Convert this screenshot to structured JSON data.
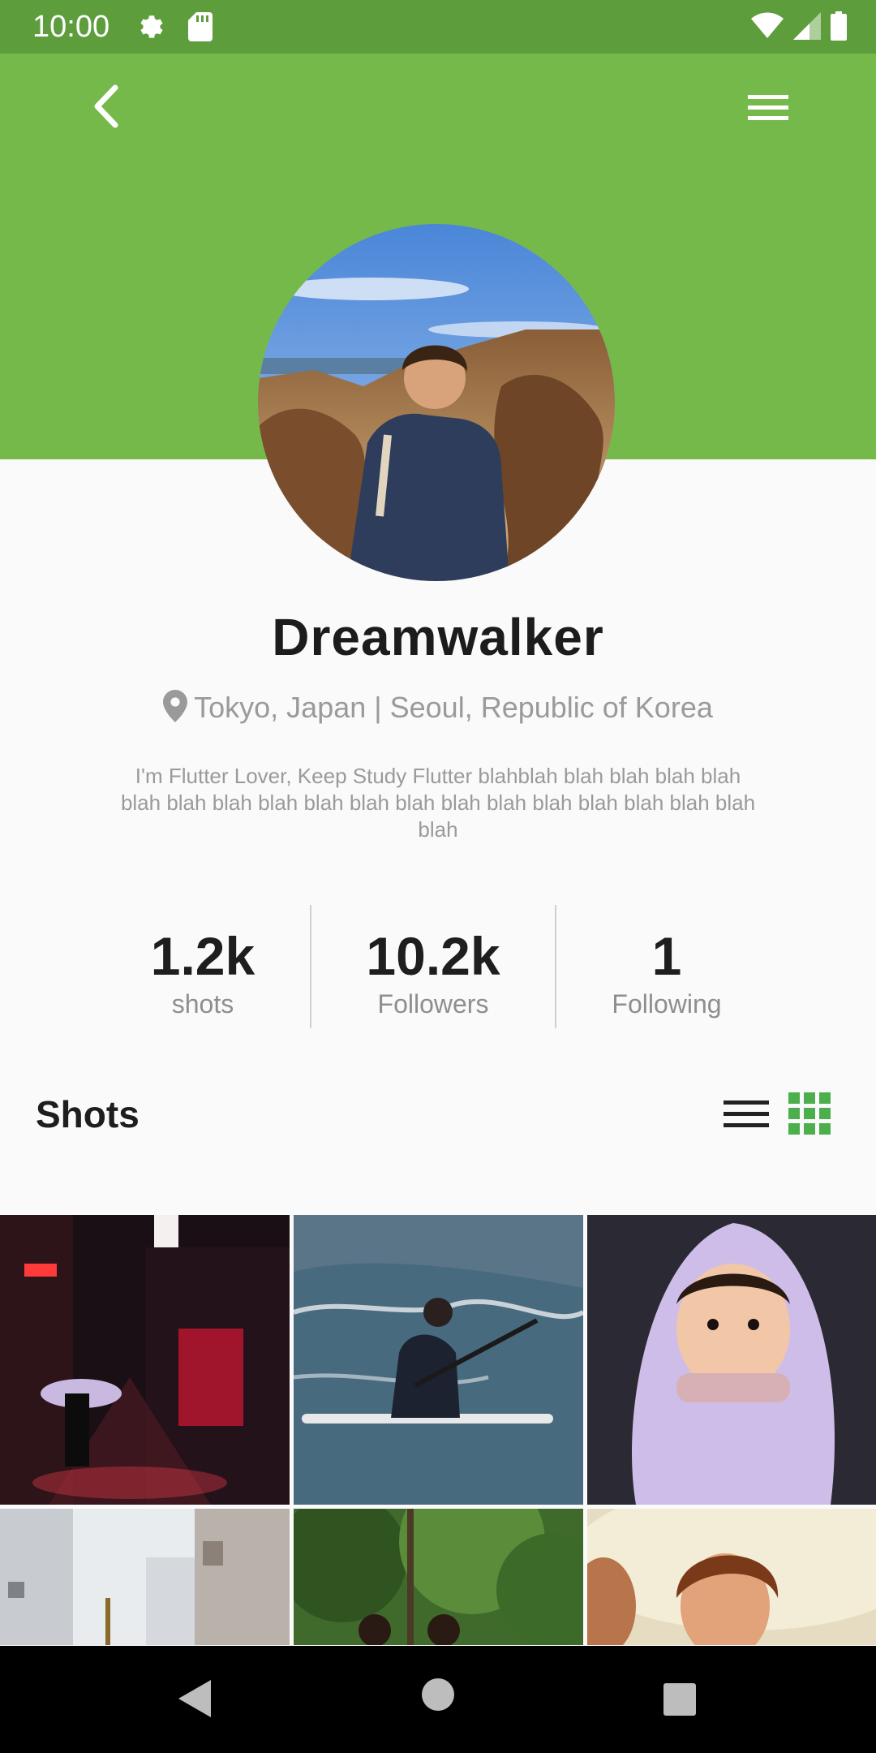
{
  "status": {
    "time": "10:00"
  },
  "profile": {
    "name": "Dreamwalker",
    "location": "Tokyo, Japan | Seoul, Republic of Korea",
    "bio": "I'm Flutter Lover, Keep Study Flutter blahblah blah blah blah blah blah blah blah blah blah blah blah blah blah blah blah blah blah blah blah"
  },
  "stats": [
    {
      "value": "1.2k",
      "label": "shots"
    },
    {
      "value": "10.2k",
      "label": "Followers"
    },
    {
      "value": "1",
      "label": "Following"
    }
  ],
  "shots": {
    "title": "Shots",
    "photos": [
      "night-alley-photo",
      "paddleboarder-photo",
      "child-hood-photo",
      "city-street-photo",
      "trees-photo",
      "women-sunset-photo"
    ]
  },
  "colors": {
    "primary": "#76b94b",
    "status_bar": "#5d9d3c",
    "accent_grid": "#4cae4c"
  },
  "icons": [
    "back-arrow-icon",
    "menu-icon",
    "location-pin-icon",
    "list-view-icon",
    "grid-view-icon"
  ]
}
